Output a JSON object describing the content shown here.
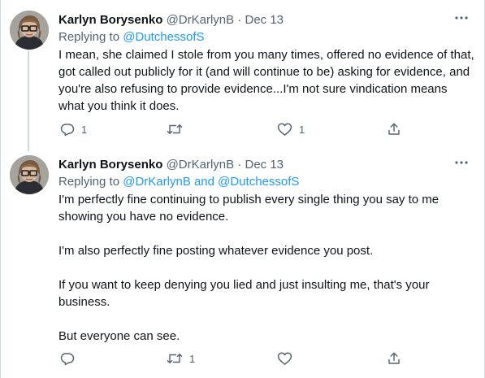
{
  "tweets": [
    {
      "display_name": "Karlyn Borysenko",
      "handle": "@DrKarlynB",
      "separator": "·",
      "date": "Dec 13",
      "replying_prefix": "Replying to ",
      "replying_mentions": "@DutchessofS",
      "body": [
        "I mean, she claimed I stole from you many times, offered no evidence of that, got called out publicly for it (and will continue to be) asking for evidence, and you're also refusing to provide evidence...I'm not sure vindication means what you think it does."
      ],
      "counts": {
        "reply": "1",
        "retweet": "",
        "like": "1"
      }
    },
    {
      "display_name": "Karlyn Borysenko",
      "handle": "@DrKarlynB",
      "separator": "·",
      "date": "Dec 13",
      "replying_prefix": "Replying to ",
      "replying_mentions": "@DrKarlynB and @DutchessofS",
      "body": [
        "I'm perfectly fine continuing to publish every single thing you say to me showing you have no evidence.",
        "I'm also perfectly fine posting whatever evidence you post.",
        "If you want to keep denying you lied and just insulting me, that's your business.",
        "But everyone can see."
      ],
      "counts": {
        "reply": "",
        "retweet": "1",
        "like": ""
      }
    }
  ],
  "icons": {
    "more": "more-icon",
    "reply": "reply-icon",
    "retweet": "retweet-icon",
    "like": "like-icon",
    "share": "share-icon"
  },
  "colors": {
    "text": "#0f1419",
    "secondary": "#536471",
    "link": "#1d9bf0",
    "border": "#cfd9de"
  }
}
